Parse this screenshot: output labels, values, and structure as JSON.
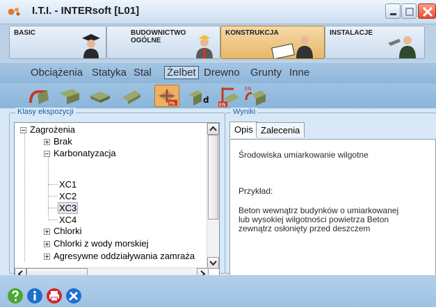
{
  "window": {
    "title": "I.T.I. - INTERsoft [L01]",
    "icons": [
      "app-logo-icon",
      "minimize-icon",
      "maximize-icon",
      "close-icon"
    ]
  },
  "modules": [
    {
      "label_line1": "BASIC",
      "label_line2": "",
      "icon": "graduate-figure-icon",
      "active": false
    },
    {
      "label_line1": "BUDOWNICTWO",
      "label_line2": "OGÓLNE",
      "icon": "builder-figure-icon",
      "active": false
    },
    {
      "label_line1": "KONSTRUKCJA",
      "label_line2": "",
      "icon": "engineer-figure-icon",
      "active": true
    },
    {
      "label_line1": "INSTALACJE",
      "label_line2": "",
      "icon": "plumber-figure-icon",
      "active": false
    }
  ],
  "menu": [
    "Obciążenia",
    "Statyka",
    "Stal",
    "Żelbet",
    "Drewno",
    "Grunty",
    "Inne"
  ],
  "menu_active": "Żelbet",
  "toolbar": {
    "pn_badge": "PN",
    "d_badge": "d",
    "en_badge_1": "EN",
    "en_badge_2": "EN",
    "tools": [
      "rebar-bending-icon",
      "beam-section-icon",
      "slab-icon",
      "column-icon",
      "cross-section-pn-icon",
      "footing-d-icon",
      "crane-en-icon",
      "wall-en-icon"
    ],
    "active_tool": "cross-section-pn-icon"
  },
  "left_panel": {
    "title": "Klasy ekspozycji",
    "tree": [
      {
        "label": "Zagrożenia",
        "level": 0,
        "expander": "minus"
      },
      {
        "label": "Brak",
        "level": 1,
        "expander": "plus"
      },
      {
        "label": "Karbonatyzacja",
        "level": 1,
        "expander": "minus"
      },
      {
        "label": "XC1",
        "level": 2,
        "expander": ""
      },
      {
        "label": "XC2",
        "level": 2,
        "expander": ""
      },
      {
        "label": "XC3",
        "level": 2,
        "expander": "",
        "selected": true
      },
      {
        "label": "XC4",
        "level": 2,
        "expander": ""
      },
      {
        "label": "Chlorki",
        "level": 1,
        "expander": "plus"
      },
      {
        "label": "Chlorki z wody morskiej",
        "level": 1,
        "expander": "plus"
      },
      {
        "label": "Agresywne oddziaływania zamraża",
        "level": 1,
        "expander": "plus"
      }
    ]
  },
  "right_panel": {
    "title": "Wyniki",
    "tabs": [
      "Opis",
      "Zalecenia"
    ],
    "active_tab": "Opis",
    "environment": "Środowiska umiarkowanie wilgotne",
    "example_label": "Przykład:",
    "example_lines": [
      "Beton wewnątrz budynków o umiarkowanej",
      "lub wysokiej wilgotności powietrza Beton",
      "zewnątrz osłonięty przed deszczem"
    ]
  },
  "bottom_icons": [
    "help-icon",
    "info-icon",
    "print-icon",
    "settings-tools-icon"
  ],
  "colors": {
    "accent": "#1e5fa8",
    "active_module": "#e8b86a",
    "close": "#e04c32"
  }
}
